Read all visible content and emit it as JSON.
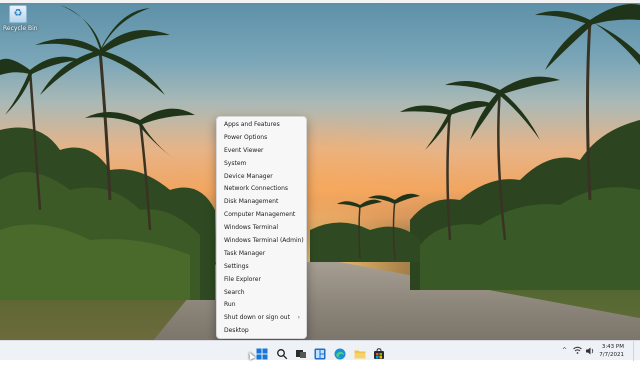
{
  "desktop": {
    "icons": [
      {
        "label": "Recycle Bin",
        "icon": "recycle-bin-icon"
      }
    ]
  },
  "context_menu": {
    "items": [
      {
        "label": "Apps and Features"
      },
      {
        "label": "Power Options"
      },
      {
        "label": "Event Viewer"
      },
      {
        "label": "System"
      },
      {
        "label": "Device Manager"
      },
      {
        "label": "Network Connections"
      },
      {
        "label": "Disk Management"
      },
      {
        "label": "Computer Management"
      },
      {
        "label": "Windows Terminal"
      },
      {
        "label": "Windows Terminal (Admin)"
      },
      {
        "label": "Task Manager"
      },
      {
        "label": "Settings"
      },
      {
        "label": "File Explorer"
      },
      {
        "label": "Search"
      },
      {
        "label": "Run"
      },
      {
        "label": "Shut down or sign out",
        "submenu_arrow": "›"
      },
      {
        "label": "Desktop"
      }
    ]
  },
  "taskbar": {
    "apps": [
      "start-icon",
      "search-icon",
      "task-view-icon",
      "widgets-icon",
      "edge-icon",
      "file-explorer-icon",
      "store-icon"
    ],
    "tray": {
      "chevron": "^",
      "network_icon": "wifi-icon",
      "sound_icon": "volume-icon",
      "time": "3:43 PM",
      "date": "7/7/2021"
    }
  },
  "colors": {
    "taskbar_bg": "#eef1f5",
    "menu_bg": "#f7f7f7",
    "accent": "#0a64c8"
  }
}
